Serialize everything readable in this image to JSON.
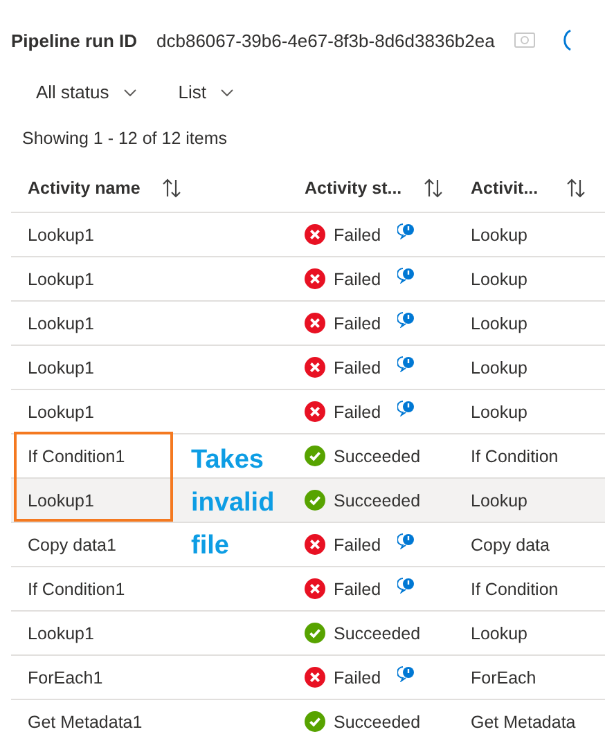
{
  "header": {
    "label": "Pipeline run ID",
    "run_id": "dcb86067-39b6-4e67-8f3b-8d6d3836b2ea"
  },
  "filters": [
    {
      "label": "All status"
    },
    {
      "label": "List"
    }
  ],
  "summary": "Showing 1 - 12 of 12 items",
  "table": {
    "columns": [
      "Activity name",
      "Activity st...",
      "Activit..."
    ],
    "rows": [
      {
        "name": "Lookup1",
        "status": "Failed",
        "kind": "failed",
        "type": "Lookup",
        "hovered": false
      },
      {
        "name": "Lookup1",
        "status": "Failed",
        "kind": "failed",
        "type": "Lookup",
        "hovered": false
      },
      {
        "name": "Lookup1",
        "status": "Failed",
        "kind": "failed",
        "type": "Lookup",
        "hovered": false
      },
      {
        "name": "Lookup1",
        "status": "Failed",
        "kind": "failed",
        "type": "Lookup",
        "hovered": false
      },
      {
        "name": "Lookup1",
        "status": "Failed",
        "kind": "failed",
        "type": "Lookup",
        "hovered": false
      },
      {
        "name": "If Condition1",
        "status": "Succeeded",
        "kind": "succeeded",
        "type": "If Condition",
        "hovered": false
      },
      {
        "name": "Lookup1",
        "status": "Succeeded",
        "kind": "succeeded",
        "type": "Lookup",
        "hovered": true
      },
      {
        "name": "Copy data1",
        "status": "Failed",
        "kind": "failed",
        "type": "Copy data",
        "hovered": false
      },
      {
        "name": "If Condition1",
        "status": "Failed",
        "kind": "failed",
        "type": "If Condition",
        "hovered": false
      },
      {
        "name": "Lookup1",
        "status": "Succeeded",
        "kind": "succeeded",
        "type": "Lookup",
        "hovered": false
      },
      {
        "name": "ForEach1",
        "status": "Failed",
        "kind": "failed",
        "type": "ForEach",
        "hovered": false
      },
      {
        "name": "Get Metadata1",
        "status": "Succeeded",
        "kind": "succeeded",
        "type": "Get Metadata",
        "hovered": false
      }
    ]
  },
  "annotation": {
    "text": "Takes invalid file"
  }
}
